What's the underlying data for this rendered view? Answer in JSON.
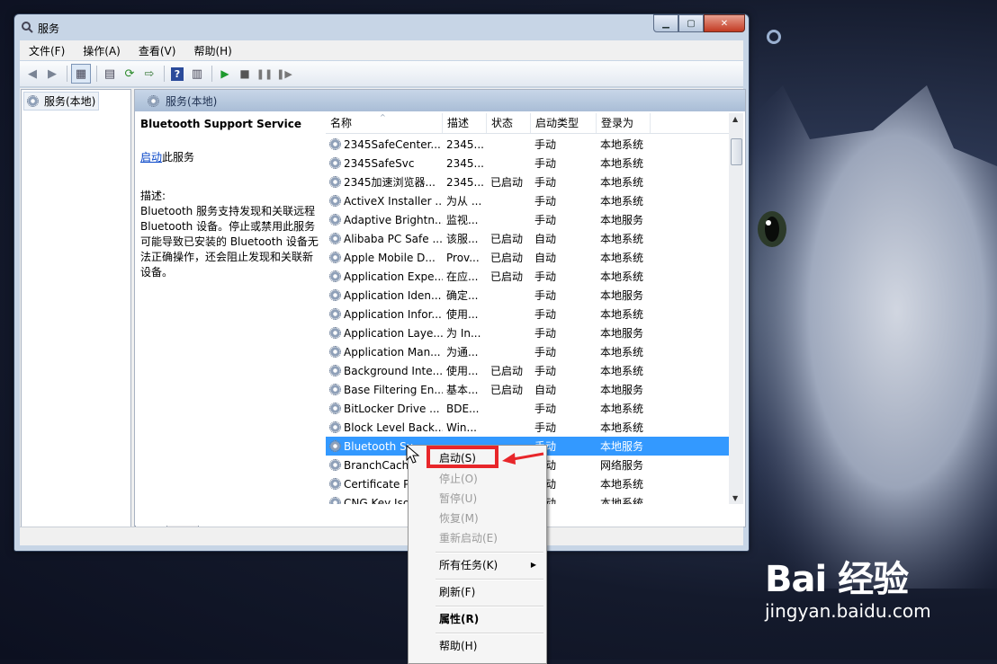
{
  "window": {
    "title": "服务"
  },
  "menu": [
    "文件(F)",
    "操作(A)",
    "查看(V)",
    "帮助(H)"
  ],
  "tree": {
    "item": "服务(本地)"
  },
  "panel_header": "服务(本地)",
  "desc": {
    "title": "Bluetooth Support Service",
    "link": "启动",
    "link_suffix": "此服务",
    "label": "描述:",
    "text": "Bluetooth 服务支持发现和关联远程 Bluetooth 设备。停止或禁用此服务可能导致已安装的 Bluetooth 设备无法正确操作，还会阻止发现和关联新设备。"
  },
  "columns": [
    "名称",
    "描述",
    "状态",
    "启动类型",
    "登录为"
  ],
  "rows": [
    [
      "2345SafeCenter...",
      "2345...",
      "",
      "手动",
      "本地系统"
    ],
    [
      "2345SafeSvc",
      "2345...",
      "",
      "手动",
      "本地系统"
    ],
    [
      "2345加速浏览器...",
      "2345...",
      "已启动",
      "手动",
      "本地系统"
    ],
    [
      "ActiveX Installer ...",
      "为从 ...",
      "",
      "手动",
      "本地系统"
    ],
    [
      "Adaptive Brightn...",
      "监视...",
      "",
      "手动",
      "本地服务"
    ],
    [
      "Alibaba PC Safe ...",
      "该服...",
      "已启动",
      "自动",
      "本地系统"
    ],
    [
      "Apple Mobile D...",
      "Prov...",
      "已启动",
      "自动",
      "本地系统"
    ],
    [
      "Application Expe...",
      "在应...",
      "已启动",
      "手动",
      "本地系统"
    ],
    [
      "Application Iden...",
      "确定...",
      "",
      "手动",
      "本地服务"
    ],
    [
      "Application Infor...",
      "使用...",
      "",
      "手动",
      "本地系统"
    ],
    [
      "Application Laye...",
      "为 In...",
      "",
      "手动",
      "本地服务"
    ],
    [
      "Application Man...",
      "为通...",
      "",
      "手动",
      "本地系统"
    ],
    [
      "Background Inte...",
      "使用...",
      "已启动",
      "手动",
      "本地系统"
    ],
    [
      "Base Filtering En...",
      "基本...",
      "已启动",
      "自动",
      "本地服务"
    ],
    [
      "BitLocker Drive ...",
      "BDE...",
      "",
      "手动",
      "本地系统"
    ],
    [
      "Block Level Back...",
      "Win...",
      "",
      "手动",
      "本地系统"
    ],
    [
      "Bluetooth Su",
      "",
      "",
      "手动",
      "本地服务"
    ],
    [
      "BranchCache",
      "",
      "",
      "手动",
      "网络服务"
    ],
    [
      "Certificate P",
      "",
      "",
      "手动",
      "本地系统"
    ],
    [
      "CNG Key Iso",
      "",
      "",
      "手动",
      "本地系统"
    ]
  ],
  "tabs": [
    "扩展",
    "标准"
  ],
  "context_menu": {
    "start": "启动(S)",
    "stop": "停止(O)",
    "pause": "暂停(U)",
    "resume": "恢复(M)",
    "restart": "重新启动(E)",
    "all_tasks": "所有任务(K)",
    "refresh": "刷新(F)",
    "properties": "属性(R)",
    "help": "帮助(H)"
  },
  "watermark": {
    "brand": "Bai 经验",
    "url": "jingyan.baidu.com"
  }
}
